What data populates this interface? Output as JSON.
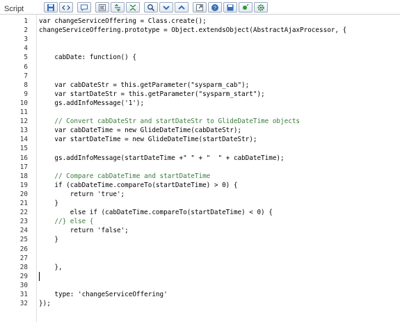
{
  "field_label": "Script",
  "toolbar": {
    "buttons": [
      "save-icon",
      "code-icon",
      "comment-icon",
      "format-icon",
      "replace-icon",
      "toggle-icon",
      "search-icon",
      "down-icon",
      "up-icon",
      "fullscreen-icon",
      "help-icon",
      "save-file-icon",
      "debug-icon",
      "settings-icon"
    ]
  },
  "lines": [
    {
      "n": "1",
      "t": "var changeServiceOffering = Class.create();"
    },
    {
      "n": "2",
      "t": "changeServiceOffering.prototype = Object.extendsObject(AbstractAjaxProcessor, {"
    },
    {
      "n": "3",
      "t": ""
    },
    {
      "n": "4",
      "t": ""
    },
    {
      "n": "5",
      "t": "    cabDate: function() {"
    },
    {
      "n": "6",
      "t": ""
    },
    {
      "n": "7",
      "t": ""
    },
    {
      "n": "8",
      "t": "    var cabDateStr = this.getParameter(\"sysparm_cab\");"
    },
    {
      "n": "9",
      "t": "    var startDateStr = this.getParameter(\"sysparm_start\");"
    },
    {
      "n": "10",
      "t": "    gs.addInfoMessage('1');"
    },
    {
      "n": "11",
      "t": ""
    },
    {
      "n": "12",
      "t": "    // Convert cabDateStr and startDateStr to GlideDateTime objects"
    },
    {
      "n": "13",
      "t": "    var cabDateTime = new GlideDateTime(cabDateStr);"
    },
    {
      "n": "14",
      "t": "    var startDateTime = new GlideDateTime(startDateStr);"
    },
    {
      "n": "15",
      "t": ""
    },
    {
      "n": "16",
      "t": "    gs.addInfoMessage(startDateTime +\" \" + \"  \" + cabDateTime);"
    },
    {
      "n": "17",
      "t": ""
    },
    {
      "n": "18",
      "t": "    // Compare cabDateTime and startDateTime"
    },
    {
      "n": "19",
      "t": "    if (cabDateTime.compareTo(startDateTime) > 0) {"
    },
    {
      "n": "20",
      "t": "        return 'true';"
    },
    {
      "n": "21",
      "t": "    }"
    },
    {
      "n": "22",
      "t": "        else if (cabDateTime.compareTo(startDateTime) < 0) {"
    },
    {
      "n": "23",
      "t": "    //} else {"
    },
    {
      "n": "24",
      "t": "        return 'false';"
    },
    {
      "n": "25",
      "t": "    }"
    },
    {
      "n": "26",
      "t": ""
    },
    {
      "n": "27",
      "t": ""
    },
    {
      "n": "28",
      "t": "    },"
    },
    {
      "n": "29",
      "t": ""
    },
    {
      "n": "30",
      "t": ""
    },
    {
      "n": "31",
      "t": "    type: 'changeServiceOffering'"
    },
    {
      "n": "32",
      "t": "});"
    }
  ]
}
